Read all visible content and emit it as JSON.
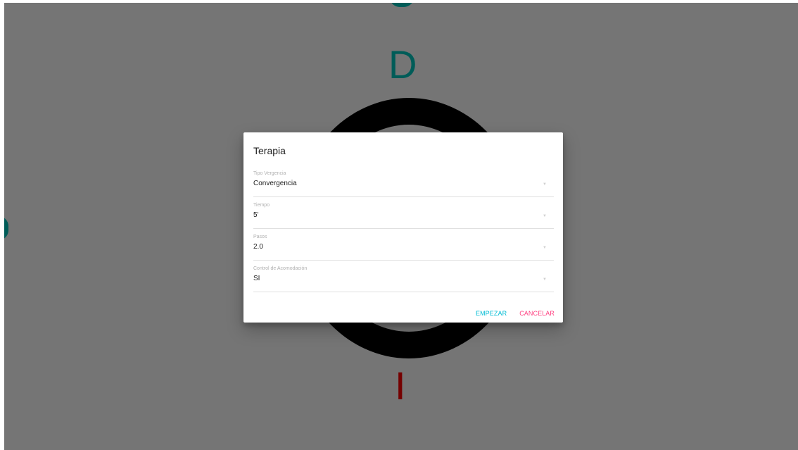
{
  "scene": {
    "top_letter": "D",
    "bottom_letter": "I",
    "colors": {
      "top_letter": "#00c8c0",
      "bottom_letter": "#ff0000",
      "ring": "#000000",
      "overlay": "rgba(0,0,0,0.54)"
    }
  },
  "dialog": {
    "title": "Terapia",
    "fields": [
      {
        "label": "Tipo Vergencia",
        "value": "Convergencia"
      },
      {
        "label": "Tiempo",
        "value": "5'"
      },
      {
        "label": "Pasos",
        "value": "2.0"
      },
      {
        "label": "Control de Acomodación",
        "value": "SI"
      }
    ],
    "actions": {
      "start_label": "EMPEZAR",
      "cancel_label": "CANCELAR"
    },
    "colors": {
      "start": "#00bcd4",
      "cancel": "#ff4081"
    }
  }
}
